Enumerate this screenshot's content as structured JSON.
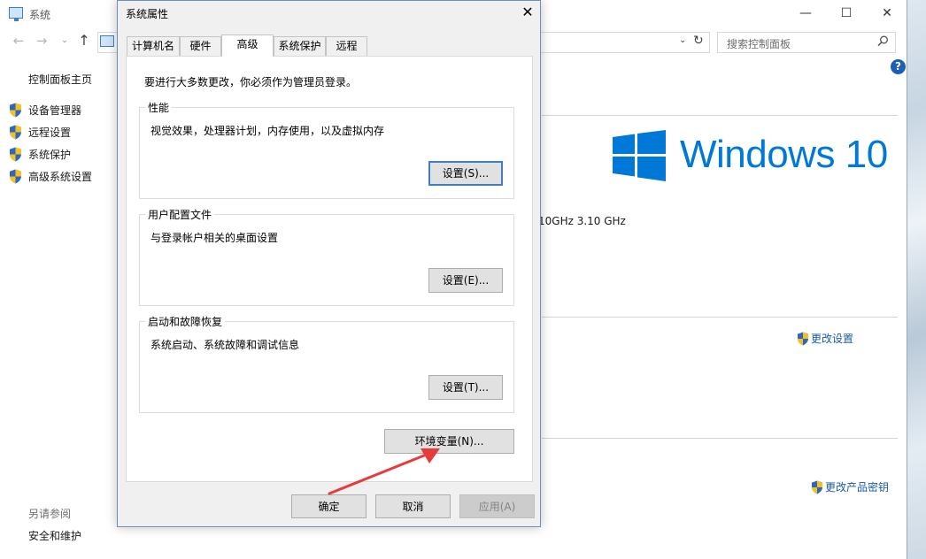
{
  "background_window": {
    "title": "系统",
    "controls": {
      "minimize": "—",
      "maximize": "☐",
      "close": "✕"
    },
    "nav": {
      "back": "←",
      "forward": "→",
      "recent": "⌄",
      "up": "↑"
    },
    "address": {
      "dropdown": "⌄",
      "refresh": "↻"
    },
    "search": {
      "placeholder": "搜索控制面板",
      "icon": "search-icon"
    },
    "help": "?",
    "sidebar": {
      "home": "控制面板主页",
      "items": [
        {
          "label": "设备管理器",
          "icon": "shield-icon"
        },
        {
          "label": "远程设置",
          "icon": "shield-icon"
        },
        {
          "label": "系统保护",
          "icon": "shield-icon"
        },
        {
          "label": "高级系统设置",
          "icon": "shield-icon"
        }
      ],
      "see_also": "另请参阅",
      "security": "安全和维护"
    },
    "brand": {
      "logo_text": "Windows 10",
      "color": "#0078d7"
    },
    "cpu_speed": "10GHz   3.10 GHz",
    "change_settings": "更改设置",
    "change_product_key": "更改产品密钥",
    "link_color": "#1a5ba8"
  },
  "dialog": {
    "title": "系统属性",
    "close": "✕",
    "tabs": [
      {
        "label": "计算机名",
        "active": false
      },
      {
        "label": "硬件",
        "active": false
      },
      {
        "label": "高级",
        "active": true
      },
      {
        "label": "系统保护",
        "active": false
      },
      {
        "label": "远程",
        "active": false
      }
    ],
    "admin_note": "要进行大多数更改，你必须作为管理员登录。",
    "groups": {
      "performance": {
        "title": "性能",
        "desc": "视觉效果，处理器计划，内存使用，以及虚拟内存",
        "button": "设置(S)..."
      },
      "user_profile": {
        "title": "用户配置文件",
        "desc": "与登录帐户相关的桌面设置",
        "button": "设置(E)..."
      },
      "startup": {
        "title": "启动和故障恢复",
        "desc": "系统启动、系统故障和调试信息",
        "button": "设置(T)..."
      }
    },
    "env_button": "环境变量(N)...",
    "ok": "确定",
    "cancel": "取消",
    "apply": "应用(A)"
  },
  "annotation": {
    "color": "#e83a3a"
  }
}
